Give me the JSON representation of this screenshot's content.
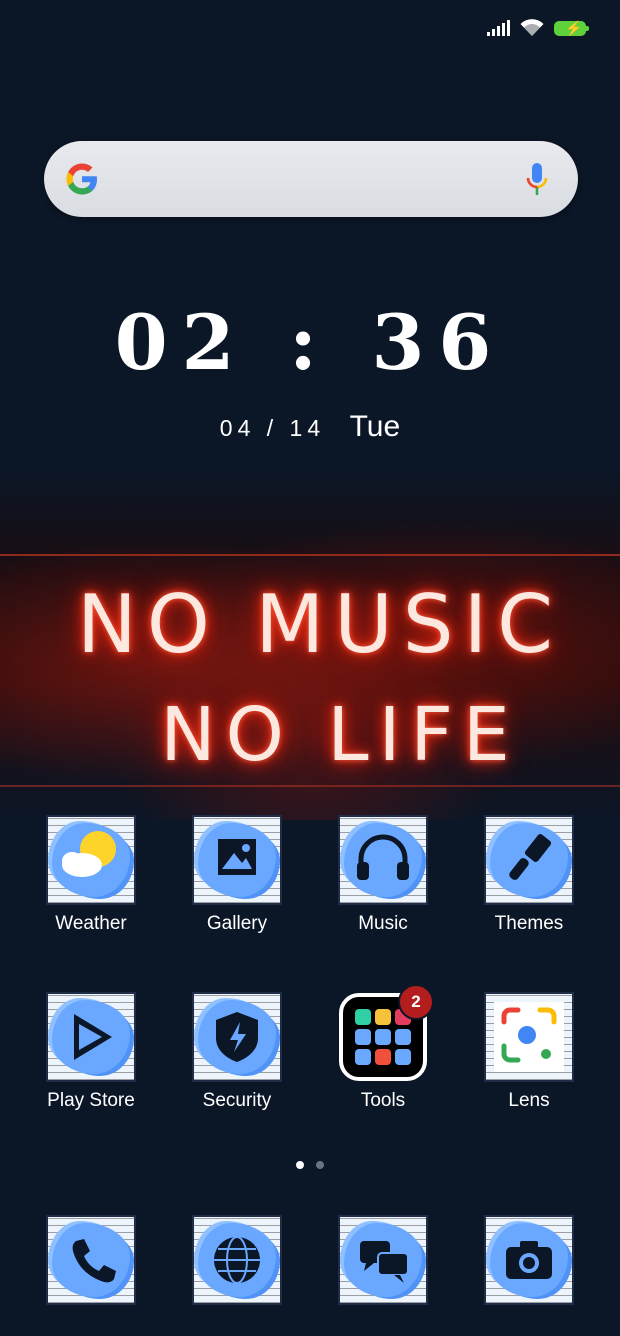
{
  "search": {
    "voice_label": "Voice search"
  },
  "clock": {
    "time": "02 : 36",
    "date": "04 / 14",
    "weekday": "Tue"
  },
  "wallpaper": {
    "line1": "NO MUSIC",
    "line2": "NO LIFE"
  },
  "apps_row1": [
    {
      "label": "Weather"
    },
    {
      "label": "Gallery"
    },
    {
      "label": "Music"
    },
    {
      "label": "Themes"
    }
  ],
  "apps_row2": [
    {
      "label": "Play Store"
    },
    {
      "label": "Security"
    },
    {
      "label": "Tools",
      "badge": "2"
    },
    {
      "label": "Lens"
    }
  ],
  "dock": [
    {
      "icon": "phone-icon"
    },
    {
      "icon": "browser-icon"
    },
    {
      "icon": "messages-icon"
    },
    {
      "icon": "camera-icon"
    }
  ],
  "pager": {
    "pages": 2,
    "current": 1
  },
  "colors": {
    "icon_accent": "#6aa8ff",
    "badge": "#b41d1d",
    "battery": "#5fd13a",
    "background": "#0b1626"
  }
}
